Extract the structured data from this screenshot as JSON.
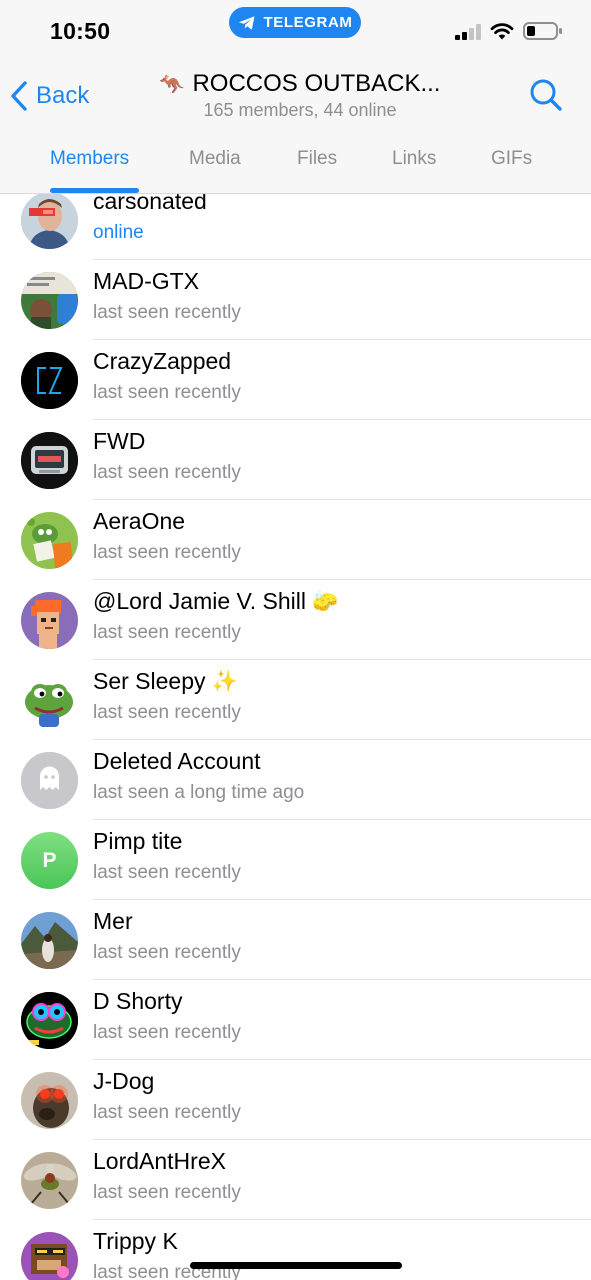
{
  "status_bar": {
    "time": "10:50",
    "app_pill": "TELEGRAM"
  },
  "nav": {
    "back_label": "Back",
    "title_emoji": "🦘",
    "title": "ROCCOS OUTBACK...",
    "subtitle": "165 members, 44 online"
  },
  "tabs": [
    {
      "label": "Members",
      "active": true
    },
    {
      "label": "Media",
      "active": false
    },
    {
      "label": "Files",
      "active": false
    },
    {
      "label": "Links",
      "active": false
    },
    {
      "label": "GIFs",
      "active": false
    }
  ],
  "members": [
    {
      "name": "carsonated",
      "badge": "",
      "status": "online",
      "avatar": "photo-man-sunglasses",
      "avatar_color": "#9fb7c9"
    },
    {
      "name": "MAD-GTX",
      "badge": "",
      "status": "last seen recently",
      "avatar": "photo-collage",
      "avatar_color": "#3f7a3a"
    },
    {
      "name": "CrazyZapped",
      "badge": "",
      "status": "last seen recently",
      "avatar": "cz-logo",
      "avatar_color": "#000000"
    },
    {
      "name": "FWD",
      "badge": "",
      "status": "last seen recently",
      "avatar": "retro-tv",
      "avatar_color": "#111111"
    },
    {
      "name": "AeraOne",
      "badge": "",
      "status": "last seen recently",
      "avatar": "pepe-reading",
      "avatar_color": "#7bbf4a"
    },
    {
      "name": "@Lord Jamie V. Shill",
      "badge": "🧽",
      "status": "last seen recently",
      "avatar": "pixel-punk",
      "avatar_color": "#8a6db8"
    },
    {
      "name": "Ser Sleepy",
      "badge": "✨",
      "status": "last seen recently",
      "avatar": "pepe-frog",
      "avatar_color": "#ffffff"
    },
    {
      "name": "Deleted Account",
      "badge": "",
      "status": "last seen a long time ago",
      "avatar": "ghost",
      "avatar_color": "#c7c7cc"
    },
    {
      "name": "Pimp tite",
      "badge": "",
      "status": "last seen recently",
      "avatar": "initial",
      "avatar_initial": "P",
      "avatar_color": "#5fd06a"
    },
    {
      "name": "Mer",
      "badge": "",
      "status": "last seen recently",
      "avatar": "photo-mountain",
      "avatar_color": "#5a86b8"
    },
    {
      "name": "D Shorty",
      "badge": "",
      "status": "last seen recently",
      "avatar": "pepe-neon",
      "avatar_color": "#000000"
    },
    {
      "name": "J-Dog",
      "badge": "",
      "status": "last seen recently",
      "avatar": "photo-laser-eyes",
      "avatar_color": "#b7a89a"
    },
    {
      "name": "LordAntHreX",
      "badge": "",
      "status": "last seen recently",
      "avatar": "photo-insect",
      "avatar_color": "#a89c86"
    },
    {
      "name": "Trippy K",
      "badge": "",
      "status": "last seen recently",
      "avatar": "pixel-monkey",
      "avatar_color": "#9b53b8"
    }
  ],
  "colors": {
    "accent": "#1f86f1",
    "secondary_text": "#8e8e93",
    "bar_background": "#f7f7f7"
  }
}
